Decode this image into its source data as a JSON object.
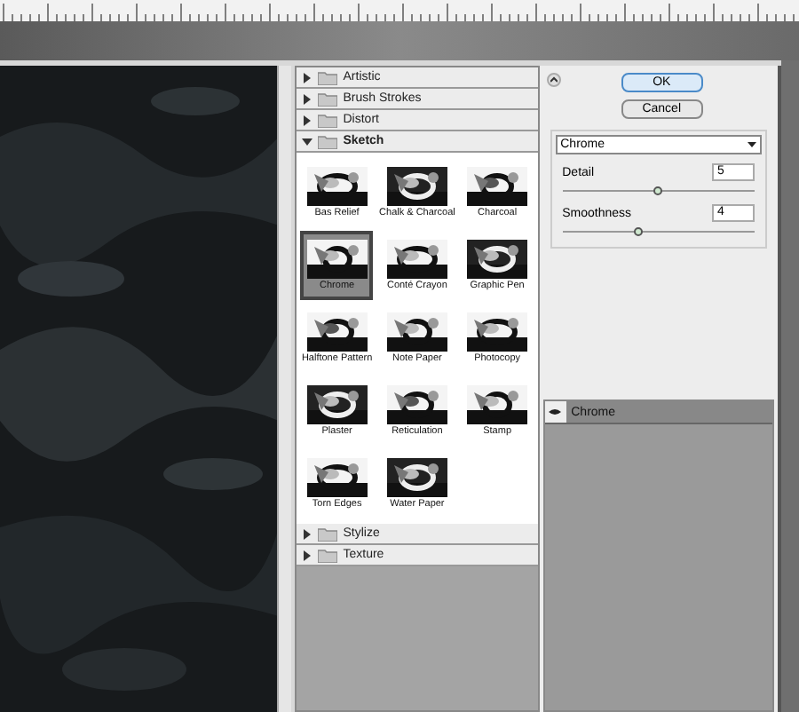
{
  "categories": [
    {
      "label": "Artistic",
      "expanded": false
    },
    {
      "label": "Brush Strokes",
      "expanded": false
    },
    {
      "label": "Distort",
      "expanded": false
    },
    {
      "label": "Sketch",
      "expanded": true,
      "filters": [
        {
          "label": "Bas Relief",
          "selected": false
        },
        {
          "label": "Chalk & Charcoal",
          "selected": false
        },
        {
          "label": "Charcoal",
          "selected": false
        },
        {
          "label": "Chrome",
          "selected": true
        },
        {
          "label": "Conté Crayon",
          "selected": false
        },
        {
          "label": "Graphic Pen",
          "selected": false
        },
        {
          "label": "Halftone Pattern",
          "selected": false
        },
        {
          "label": "Note Paper",
          "selected": false
        },
        {
          "label": "Photocopy",
          "selected": false
        },
        {
          "label": "Plaster",
          "selected": false
        },
        {
          "label": "Reticulation",
          "selected": false
        },
        {
          "label": "Stamp",
          "selected": false
        },
        {
          "label": "Torn Edges",
          "selected": false
        },
        {
          "label": "Water Paper",
          "selected": false
        }
      ]
    },
    {
      "label": "Stylize",
      "expanded": false
    },
    {
      "label": "Texture",
      "expanded": false
    }
  ],
  "buttons": [
    {
      "label": "OK",
      "kind": "default"
    },
    {
      "label": "Cancel",
      "kind": "normal"
    }
  ],
  "filter_select": {
    "value": "Chrome"
  },
  "parameters": [
    {
      "label": "Detail",
      "value": "5",
      "level": 0.5
    },
    {
      "label": "Smoothness",
      "value": "4",
      "level": 0.4
    }
  ],
  "effect_layers": [
    {
      "label": "Chrome"
    }
  ]
}
